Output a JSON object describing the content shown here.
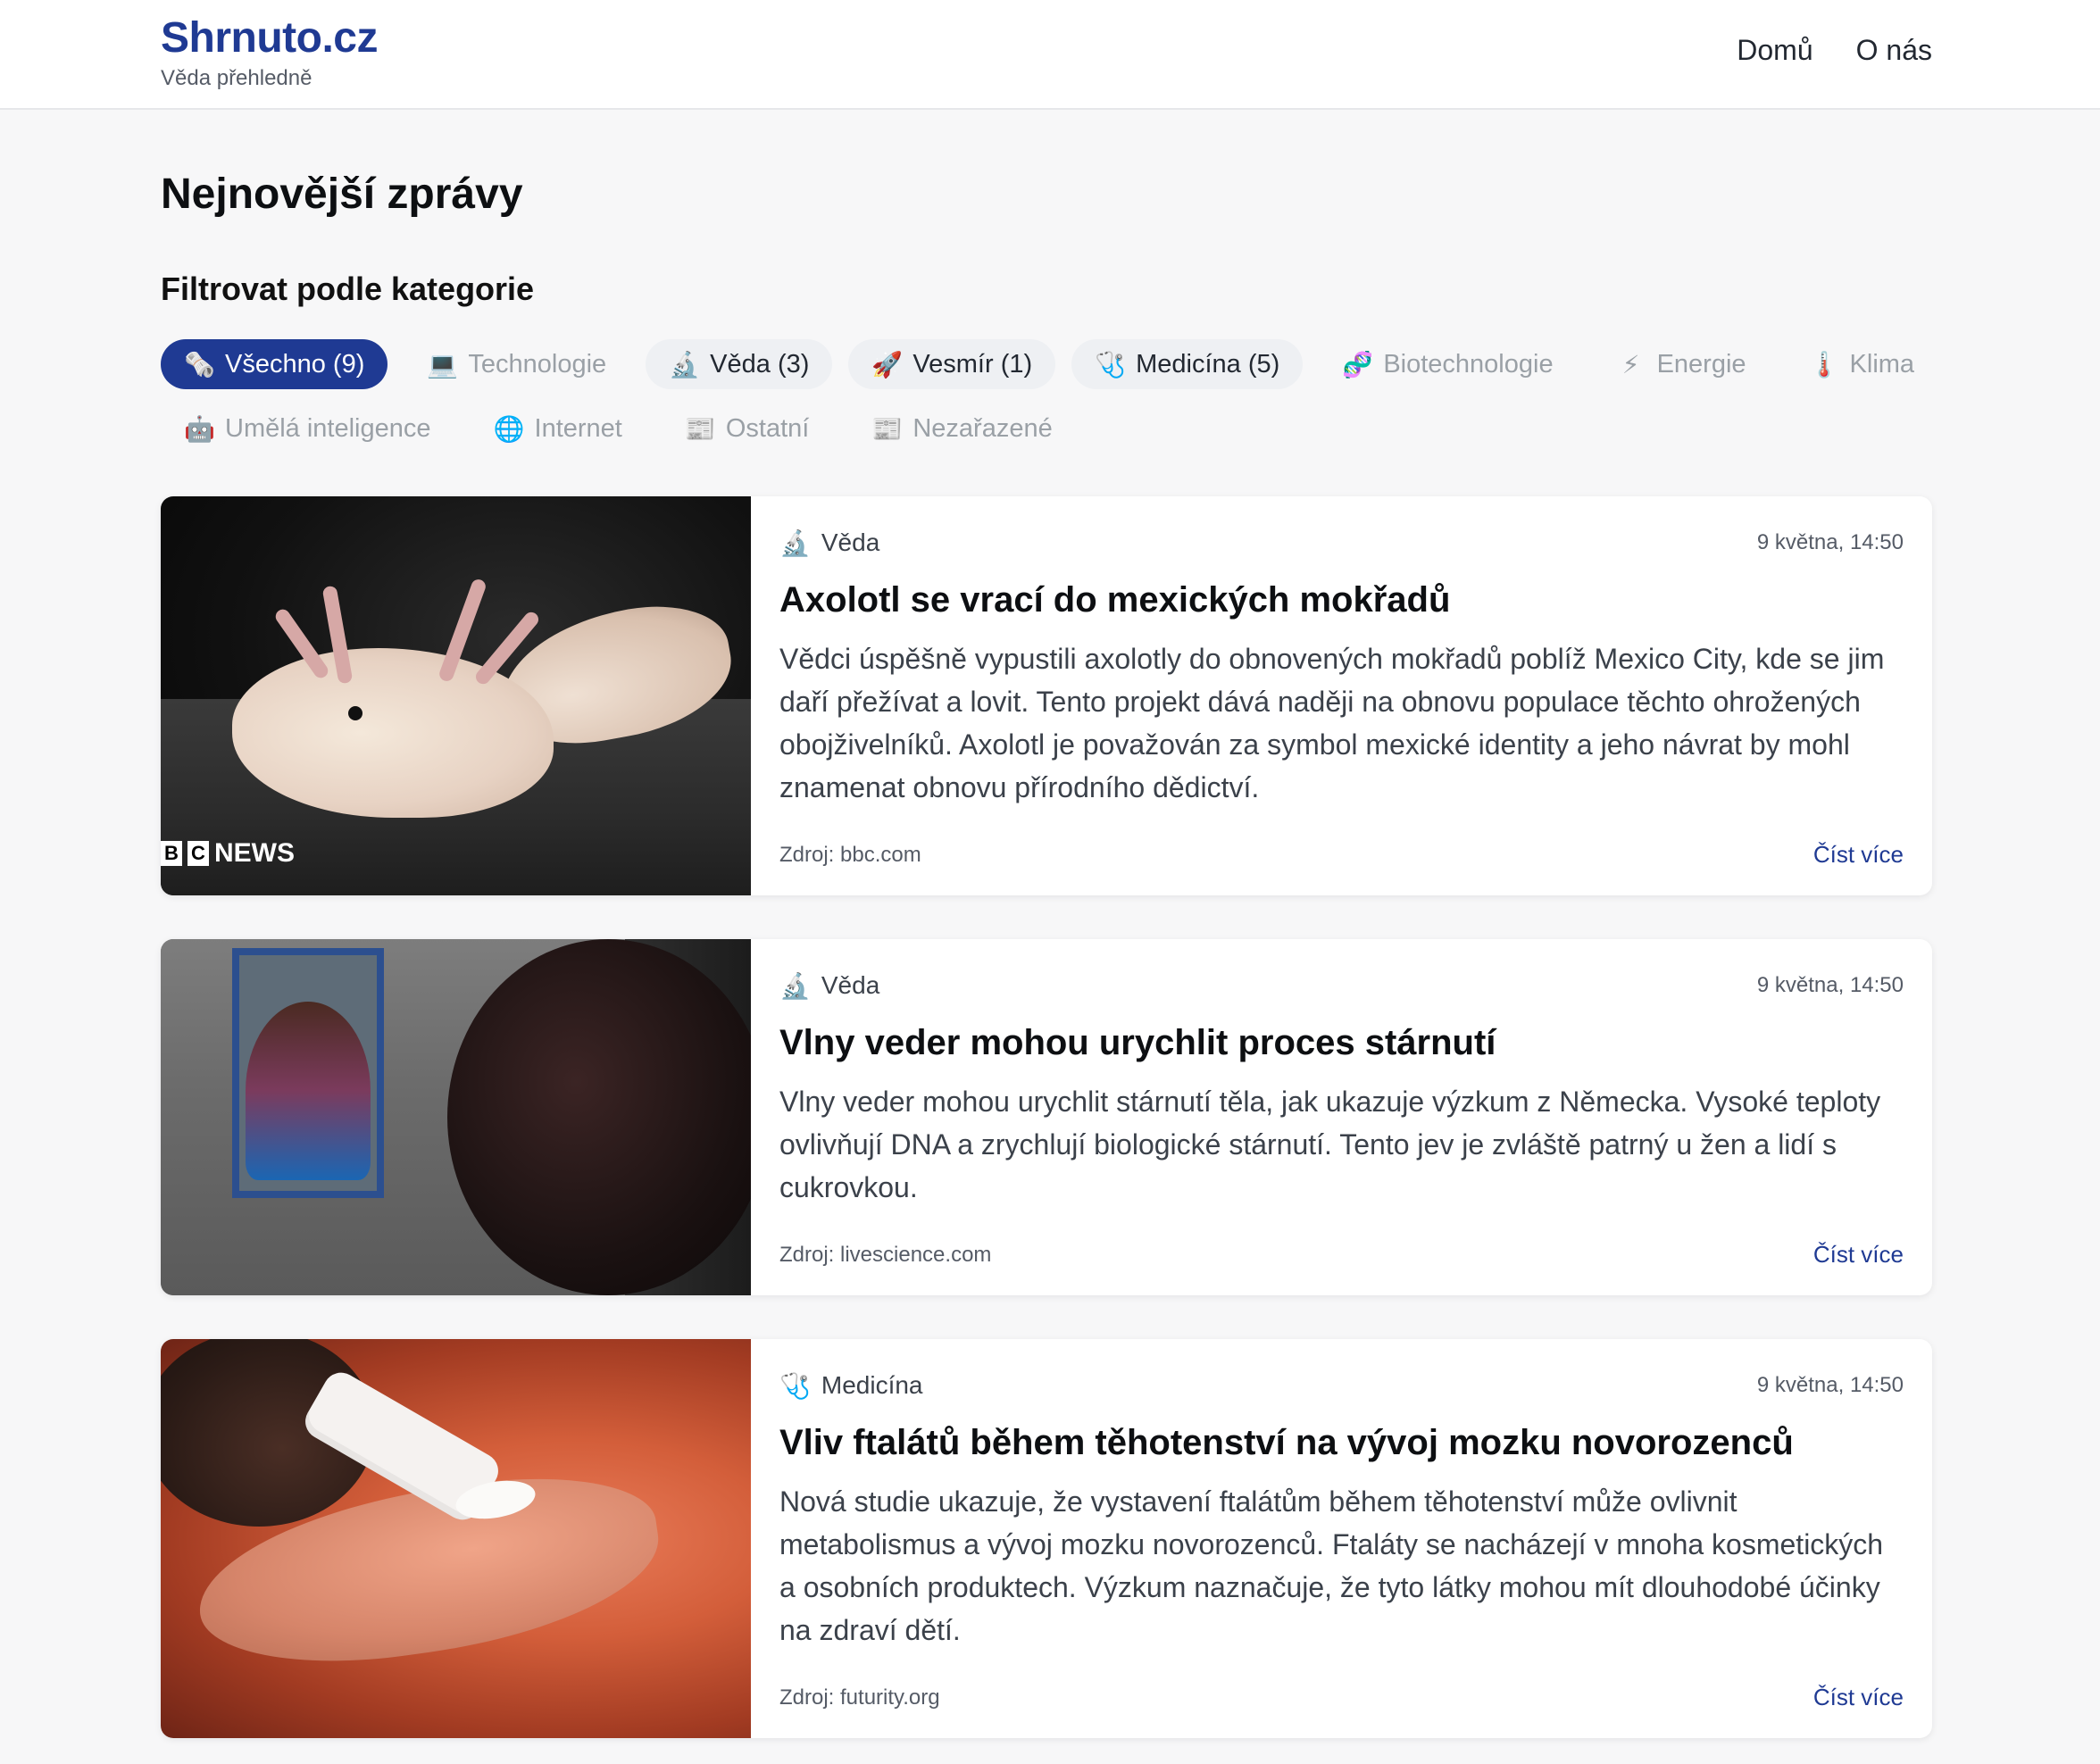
{
  "brand": {
    "name": "Shrnuto.cz",
    "tagline": "Věda přehledně"
  },
  "nav": [
    {
      "label": "Domů"
    },
    {
      "label": "O nás"
    }
  ],
  "page": {
    "title": "Nejnovější zprávy",
    "filter_title": "Filtrovat podle kategorie"
  },
  "chips": [
    {
      "icon": "🗞️",
      "label": "Všechno (9)"
    },
    {
      "icon": "💻",
      "label": "Technologie"
    },
    {
      "icon": "🔬",
      "label": "Věda (3)"
    },
    {
      "icon": "🚀",
      "label": "Vesmír (1)"
    },
    {
      "icon": "🩺",
      "label": "Medicína (5)"
    },
    {
      "icon": "🧬",
      "label": "Biotechnologie"
    },
    {
      "icon": "⚡",
      "label": "Energie"
    },
    {
      "icon": "🌡️",
      "label": "Klima"
    },
    {
      "icon": "🤖",
      "label": "Umělá inteligence"
    },
    {
      "icon": "🌐",
      "label": "Internet"
    },
    {
      "icon": "📰",
      "label": "Ostatní"
    },
    {
      "icon": "📰",
      "label": "Nezařazené"
    }
  ],
  "articles": [
    {
      "category_icon": "🔬",
      "category": "Věda",
      "date": "9 května, 14:50",
      "title": "Axolotl se vrací do mexických mokřadů",
      "excerpt": "Vědci úspěšně vypustili axolotly do obnovených mokřadů poblíž Mexico City, kde se jim daří přežívat a lovit. Tento projekt dává naději na obnovu populace těchto ohrožených obojživelníků. Axolotl je považován za symbol mexické identity a jeho návrat by mohl znamenat obnovu přírodního dědictví.",
      "source": "Zdroj: bbc.com",
      "more": "Číst více",
      "watermark": {
        "b": "B",
        "c": "C",
        "news": "NEWS"
      }
    },
    {
      "category_icon": "🔬",
      "category": "Věda",
      "date": "9 května, 14:50",
      "title": "Vlny veder mohou urychlit proces stárnutí",
      "excerpt": "Vlny veder mohou urychlit stárnutí těla, jak ukazuje výzkum z Německa. Vysoké teploty ovlivňují DNA a zrychlují biologické stárnutí. Tento jev je zvláště patrný u žen a lidí s cukrovkou.",
      "source": "Zdroj: livescience.com",
      "more": "Číst více"
    },
    {
      "category_icon": "🩺",
      "category": "Medicína",
      "date": "9 května, 14:50",
      "title": "Vliv ftalátů během těhotenství na vývoj mozku novorozenců",
      "excerpt": "Nová studie ukazuje, že vystavení ftalátům během těhotenství může ovlivnit metabolismus a vývoj mozku novorozenců. Ftaláty se nacházejí v mnoha kosmetických a osobních produktech. Výzkum naznačuje, že tyto látky mohou mít dlouhodobé účinky na zdraví dětí.",
      "source": "Zdroj: futurity.org",
      "more": "Číst více"
    }
  ],
  "colors": {
    "accent": "#1f3a93",
    "chip_count_bg": "#eef0f3",
    "muted_text": "#9aa0a6"
  }
}
